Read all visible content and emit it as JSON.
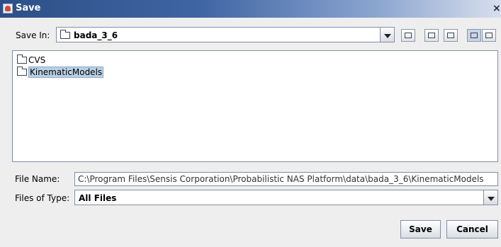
{
  "window": {
    "title": "Save",
    "close_glyph": "×"
  },
  "save_in": {
    "label": "Save In:",
    "value": "bada_3_6"
  },
  "toolbar": {
    "buttons": [
      {
        "name": "up-one-level-icon"
      },
      {
        "name": "home-icon"
      },
      {
        "name": "new-folder-icon"
      },
      {
        "name": "list-view-icon",
        "selected": true
      },
      {
        "name": "details-view-icon"
      }
    ]
  },
  "files": [
    {
      "name": "CVS",
      "selected": false
    },
    {
      "name": "KinematicModels",
      "selected": true
    }
  ],
  "file_name": {
    "label": "File Name:",
    "value": "C:\\Program Files\\Sensis Corporation\\Probabilistic NAS Platform\\data\\bada_3_6\\KinematicModels"
  },
  "file_type": {
    "label": "Files of Type:",
    "value": "All Files"
  },
  "actions": {
    "save": "Save",
    "cancel": "Cancel"
  },
  "colors": {
    "title_bar": "#3f65a3",
    "selection": "#b8cfe5"
  }
}
